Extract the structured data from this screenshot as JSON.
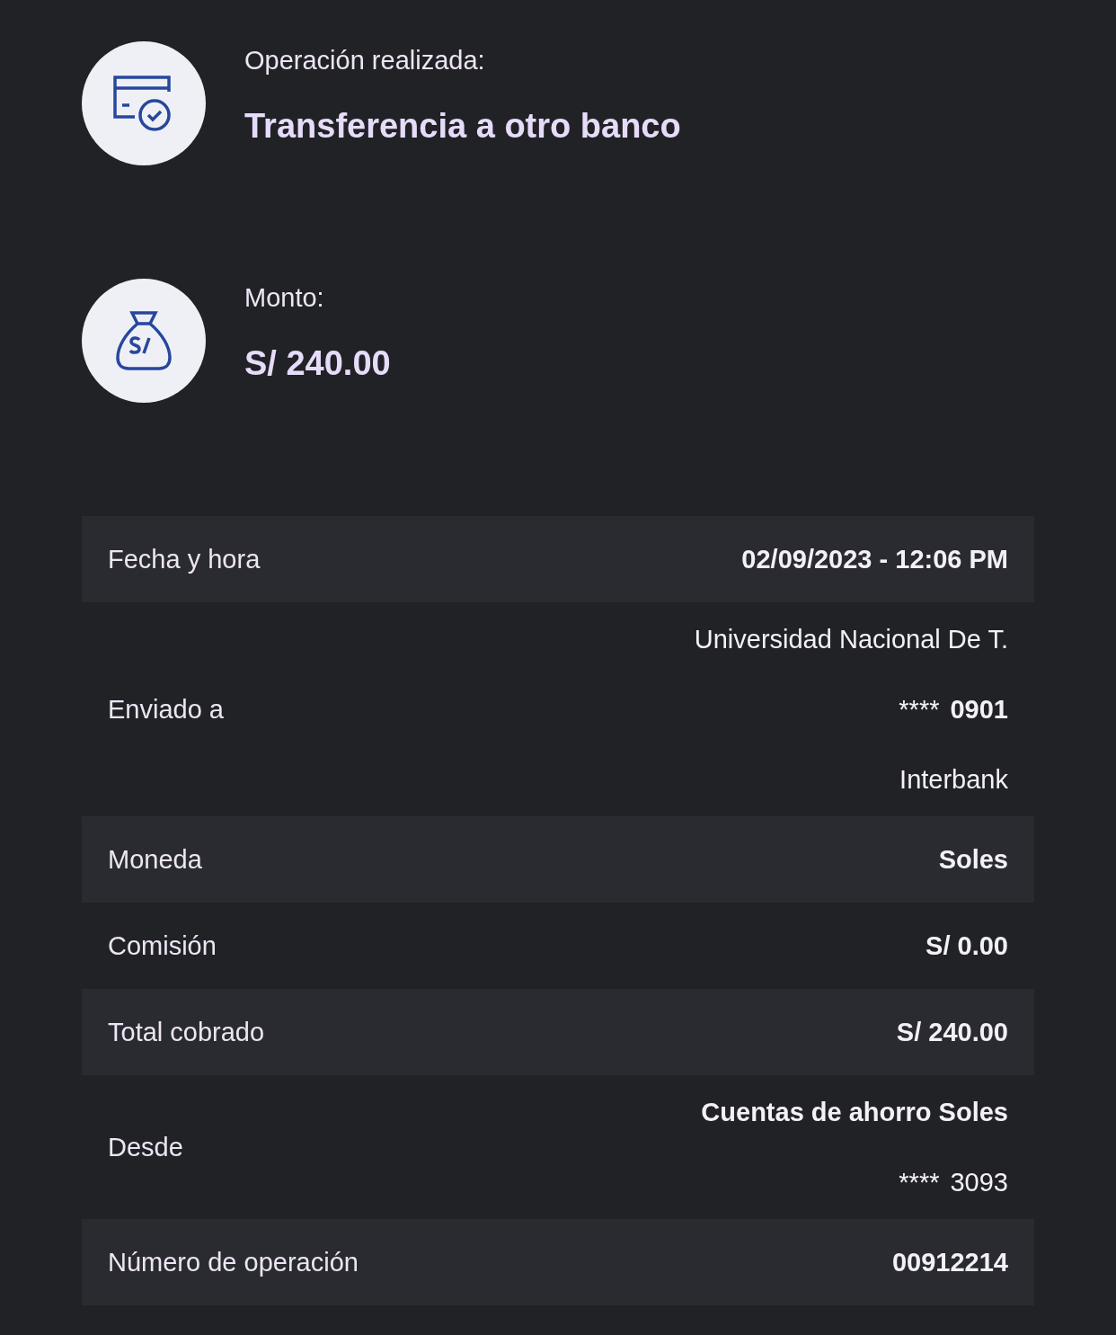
{
  "summary": [
    {
      "kind": "operation",
      "label": "Operación realizada:",
      "value": "Transferencia a otro banco"
    },
    {
      "kind": "amount",
      "label": "Monto:",
      "value": "S/ 240.00"
    }
  ],
  "details": [
    {
      "label": "Fecha y hora",
      "lines": [
        {
          "text": "02/09/2023 - 12:06 PM",
          "bold": true
        }
      ]
    },
    {
      "label": "Enviado a",
      "lines": [
        {
          "text": "Universidad Nacional De T.",
          "bold": false
        },
        {
          "mask": "****",
          "text": "0901",
          "bold": true
        },
        {
          "text": "Interbank",
          "bold": false
        }
      ]
    },
    {
      "label": "Moneda",
      "lines": [
        {
          "text": "Soles",
          "bold": true
        }
      ]
    },
    {
      "label": "Comisión",
      "lines": [
        {
          "text": "S/ 0.00",
          "bold": true
        }
      ]
    },
    {
      "label": "Total cobrado",
      "lines": [
        {
          "text": "S/ 240.00",
          "bold": true
        }
      ]
    },
    {
      "label": "Desde",
      "lines": [
        {
          "text": "Cuentas de ahorro Soles",
          "bold": true
        },
        {
          "mask": "****",
          "text": "3093",
          "bold": false
        }
      ]
    },
    {
      "label": "Número de operación",
      "lines": [
        {
          "text": "00912214",
          "bold": true
        }
      ]
    }
  ]
}
